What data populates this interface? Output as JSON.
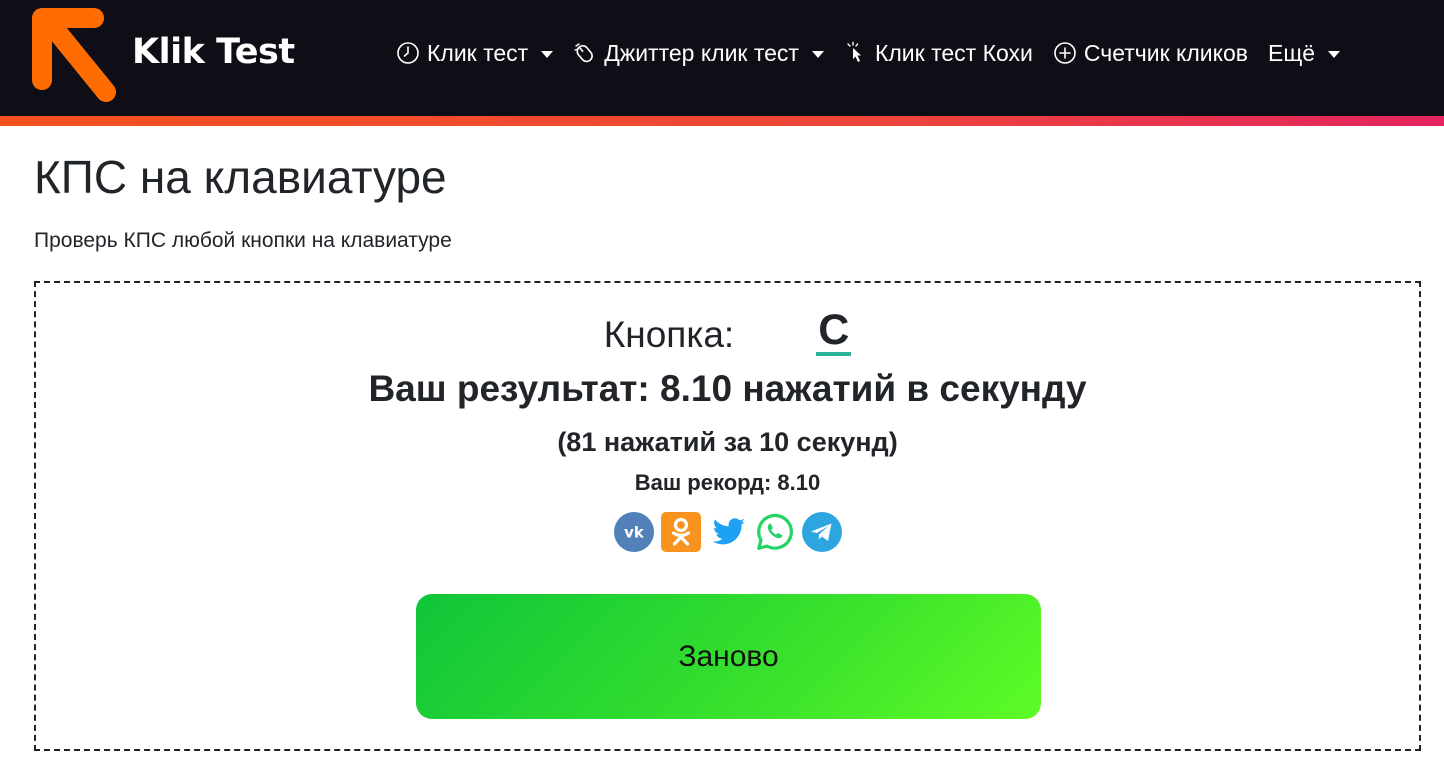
{
  "header": {
    "logo_text": "Klik Test",
    "nav": [
      {
        "label": "Клик тест",
        "icon": "clock-icon",
        "dropdown": true
      },
      {
        "label": "Джиттер клик тест",
        "icon": "mouse-icon",
        "dropdown": true
      },
      {
        "label": "Клик тест Кохи",
        "icon": "cursor-click-icon",
        "dropdown": false
      },
      {
        "label": "Счетчик кликов",
        "icon": "plus-circle-icon",
        "dropdown": false
      },
      {
        "label": "Ещё",
        "icon": null,
        "dropdown": true
      }
    ],
    "colors": {
      "bar": "#0f0e17",
      "strip_start": "#f4511e",
      "strip_end": "#e3245f",
      "logo_arrow": "#ff6d00"
    }
  },
  "main": {
    "title": "КПС на клавиатуре",
    "subtitle": "Проверь КПС любой кнопки на клавиатуре"
  },
  "test": {
    "key_label": "Кнопка:",
    "key_value": "C",
    "result": "Ваш результат: 8.10 нажатий в секунду",
    "detail": "(81 нажатий за 10 секунд)",
    "record": "Ваш рекорд: 8.10",
    "share": [
      {
        "icon": "vk-icon",
        "color": "#5181b8"
      },
      {
        "icon": "odnoklassniki-icon",
        "color": "#f7931e"
      },
      {
        "icon": "twitter-icon",
        "color": "#1da1f2"
      },
      {
        "icon": "whatsapp-icon",
        "color": "#25d366"
      },
      {
        "icon": "telegram-icon",
        "color": "#2ca5e0"
      }
    ],
    "restart_label": "Заново",
    "colors": {
      "key_underline": "#2bb39a",
      "button_start": "#0fc63a",
      "button_end": "#5efc26"
    }
  }
}
